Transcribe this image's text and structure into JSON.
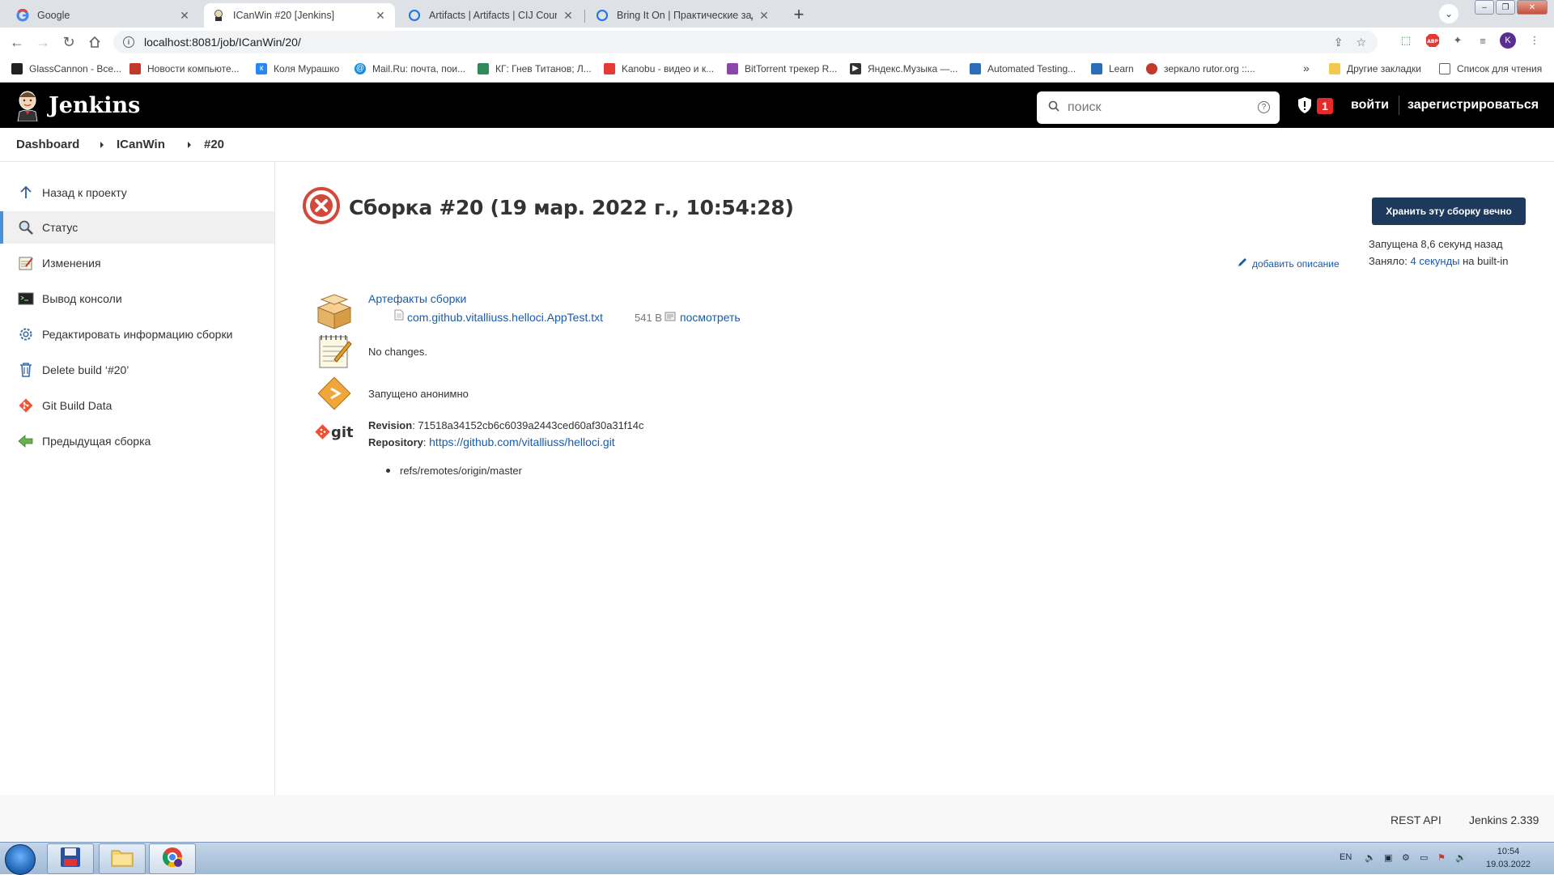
{
  "browser": {
    "tabs": [
      {
        "title": "Google",
        "active": false
      },
      {
        "title": "ICanWin #20 [Jenkins]",
        "active": true
      },
      {
        "title": "Artifacts | Artifacts | CIJ Coursew",
        "active": false
      },
      {
        "title": "Bring It On | Практические зада",
        "active": false
      }
    ],
    "url": "localhost:8081/job/ICanWin/20/",
    "profile_initial": "K",
    "bookmarks": [
      {
        "label": "GlassCannon - Все...",
        "color": "#222222"
      },
      {
        "label": "Новости компьюте...",
        "color": "#c0392b"
      },
      {
        "label": "Коля Мурашко",
        "color": "#2787f5"
      },
      {
        "label": "Mail.Ru: почта, пои...",
        "color": "#168de2"
      },
      {
        "label": "КГ: Гнев Титанов; Л...",
        "color": "#2e8b57"
      },
      {
        "label": "Kanobu - видео и к...",
        "color": "#e53935"
      },
      {
        "label": "BitTorrent трекер R...",
        "color": "#8e44ad"
      },
      {
        "label": "Яндекс.Музыка —...",
        "color": "#333333"
      },
      {
        "label": "Automated Testing...",
        "color": "#2a6ebb"
      },
      {
        "label": "Learn",
        "color": "#2a6ebb"
      },
      {
        "label": "зеркало rutor.org ::...",
        "color": "#c0392b"
      }
    ],
    "more_bookmarks": "»",
    "other_bookmarks": "Другие закладки",
    "reading_list": "Список для чтения"
  },
  "jenkins": {
    "app_name": "Jenkins",
    "search_placeholder": "поиск",
    "alert_count": "1",
    "login": "войти",
    "register": "зарегистрироваться"
  },
  "breadcrumb": [
    "Dashboard",
    "ICanWin",
    "#20"
  ],
  "sidebar": {
    "items": [
      {
        "label": "Назад к проекту",
        "icon": "arrow-up-icon"
      },
      {
        "label": "Статус",
        "icon": "search-icon"
      },
      {
        "label": "Изменения",
        "icon": "notepad-icon"
      },
      {
        "label": "Вывод консоли",
        "icon": "terminal-icon"
      },
      {
        "label": "Редактировать информацию сборки",
        "icon": "gear-icon"
      },
      {
        "label": "Delete build ‘#20’",
        "icon": "trash-icon"
      },
      {
        "label": "Git Build Data",
        "icon": "git-icon"
      },
      {
        "label": "Предыдущая сборка",
        "icon": "arrow-left-icon"
      }
    ],
    "active_index": 1
  },
  "build": {
    "status": "failed",
    "title": "Сборка #20 (19 мар. 2022 г., 10:54:28)",
    "keep_forever_label": "Хранить эту сборку вечно",
    "started": "Запущена 8,6 секунд назад",
    "took_prefix": "Заняло: ",
    "took_value": "4 секунды",
    "took_suffix": " на built-in",
    "add_description": "добавить описание",
    "artifacts_heading": "Артефакты сборки",
    "artifact": {
      "name": "com.github.vitalliuss.helloci.AppTest.txt",
      "size": "541 B",
      "view_label": "посмотреть"
    },
    "changes": "No changes.",
    "cause": "Запущено анонимно",
    "git": {
      "revision_label": "Revision",
      "revision": "71518a34152cb6c6039a2443ced60af30a31f14c",
      "repository_label": "Repository",
      "repository": "https://github.com/vitalliuss/helloci.git",
      "branches": [
        "refs/remotes/origin/master"
      ]
    }
  },
  "footer": {
    "rest_api": "REST API",
    "version": "Jenkins 2.339"
  },
  "taskbar": {
    "lang": "EN",
    "time": "10:54",
    "date": "19.03.2022"
  }
}
